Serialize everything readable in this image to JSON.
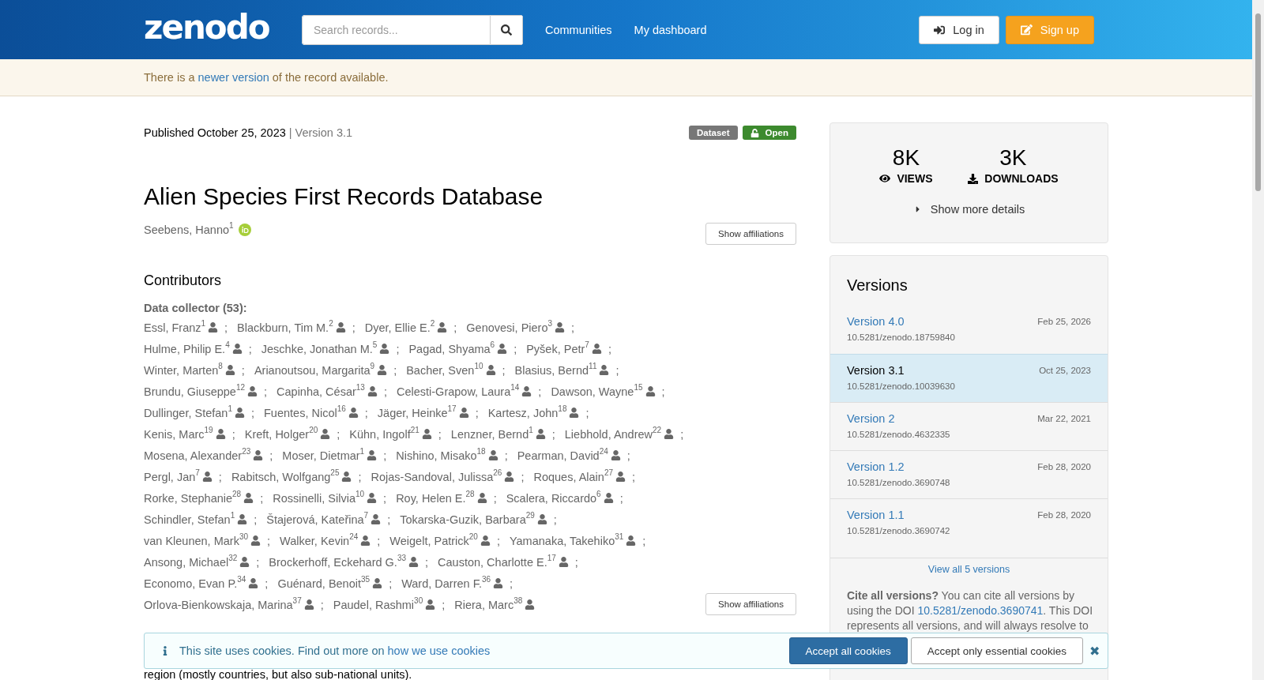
{
  "header": {
    "logo": "zenodo",
    "search": {
      "placeholder": "Search records..."
    },
    "nav_links": [
      "Communities",
      "My dashboard"
    ],
    "login": "Log in",
    "signup": "Sign up"
  },
  "notice": {
    "before": "There is a ",
    "link": "newer version",
    "after": " of the record available."
  },
  "record": {
    "published": "Published October 25, 2023",
    "version": "| Version 3.1",
    "badges": [
      {
        "label": "Dataset",
        "kind": "type"
      },
      {
        "label": "Open",
        "kind": "access"
      }
    ],
    "title": "Alien Species First Records Database",
    "creator": {
      "name": "Seebens, Hanno$^{1}$",
      "orcid": true
    },
    "show_affiliations": "Show affiliations"
  },
  "contributors": {
    "heading": "Contributors",
    "role": "Data collector (53):",
    "separator": ";",
    "show_affiliations": "Show affiliations",
    "rows": [
      [
        "Essl, Franz$^{1}$",
        "Blackburn, Tim M.$^{2}$",
        "Dyer, Ellie E.$^{2}$",
        "Genovesi, Piero$^{3}$"
      ],
      [
        "Hulme, Philip E.$^{4}$",
        "Jeschke, Jonathan M.$^{5}$",
        "Pagad, Shyama$^{6}$",
        "Pyšek, Petr$^{7}$"
      ],
      [
        "Winter, Marten$^{8}$",
        "Arianoutsou, Margarita$^{9}$",
        "Bacher, Sven$^{10}$",
        "Blasius, Bernd$^{11}$"
      ],
      [
        "Brundu, Giuseppe$^{12}$",
        "Capinha, César$^{13}$",
        "Celesti-Grapow, Laura$^{14}$",
        "Dawson, Wayne$^{15}$"
      ],
      [
        "Dullinger, Stefan$^{1}$",
        "Fuentes, Nicol$^{16}$",
        "Jäger, Heinke$^{17}$",
        "Kartesz, John$^{18}$"
      ],
      [
        "Kenis, Marc$^{19}$",
        "Kreft, Holger$^{20}$",
        "Kühn, Ingolf$^{21}$",
        "Lenzner, Bernd$^{1}$",
        "Liebhold, Andrew$^{22}$"
      ],
      [
        "Mosena, Alexander$^{23}$",
        "Moser, Dietmar$^{1}$",
        "Nishino, Misako$^{18}$",
        "Pearman, David$^{24}$"
      ],
      [
        "Pergl, Jan$^{7}$",
        "Rabitsch, Wolfgang$^{25}$",
        "Rojas-Sandoval, Julissa$^{26}$",
        "Roques, Alain$^{27}$"
      ],
      [
        "Rorke, Stephanie$^{28}$",
        "Rossinelli, Silvia$^{10}$",
        "Roy, Helen E.$^{28}$",
        "Scalera, Riccardo$^{6}$"
      ],
      [
        "Schindler, Stefan$^{1}$",
        "Štajerová, Kateřina$^{7}$",
        "Tokarska-Guzik, Barbara$^{29}$"
      ],
      [
        "van Kleunen, Mark$^{30}$",
        "Walker, Kevin$^{24}$",
        "Weigelt, Patrick$^{20}$",
        "Yamanaka, Takehiko$^{31}$"
      ],
      [
        "Ansong, Michael$^{32}$",
        "Brockerhoff, Eckehard G.$^{33}$",
        "Causton, Charlotte E.$^{17}$"
      ],
      [
        "Economo, Evan P.$^{34}$",
        "Guénard, Benoit$^{35}$",
        "Ward, Darren F.$^{36}$"
      ],
      [
        "Orlova-Bienkowskaja, Marina$^{37}$",
        "Paudel, Rashmi$^{30}$",
        "Riera, Marc$^{38}$"
      ]
    ]
  },
  "description_fragment": "region (mostly countries, but also sub-national units).",
  "stats": {
    "items": [
      {
        "value": "8K",
        "label": "VIEWS",
        "kind": "views"
      },
      {
        "value": "3K",
        "label": "DOWNLOADS",
        "kind": "downloads"
      }
    ],
    "more": "Show more details"
  },
  "versions": {
    "heading": "Versions",
    "items": [
      {
        "label": "Version 4.0",
        "date": "Feb 25, 2026",
        "doi": "10.5281/zenodo.18759840",
        "selected": false
      },
      {
        "label": "Version 3.1",
        "date": "Oct 25, 2023",
        "doi": "10.5281/zenodo.10039630",
        "selected": true
      },
      {
        "label": "Version 2",
        "date": "Mar 22, 2021",
        "doi": "10.5281/zenodo.4632335",
        "selected": false
      },
      {
        "label": "Version 1.2",
        "date": "Feb 28, 2020",
        "doi": "10.5281/zenodo.3690748",
        "selected": false
      },
      {
        "label": "Version 1.1",
        "date": "Feb 28, 2020",
        "doi": "10.5281/zenodo.3690742",
        "selected": false
      }
    ],
    "view_all": "View all 5 versions",
    "cite": {
      "lead": "Cite all versions?",
      "before": " You can cite all versions by using the DOI ",
      "doi": "10.5281/zenodo.3690741",
      "after": ". This DOI represents all versions, and will always resolve to"
    }
  },
  "cookies": {
    "before": "This site uses cookies. Find out more on ",
    "link": "how we use cookies",
    "accept_all": "Accept all cookies",
    "accept_essential": "Accept only essential cookies",
    "close": "✖"
  }
}
